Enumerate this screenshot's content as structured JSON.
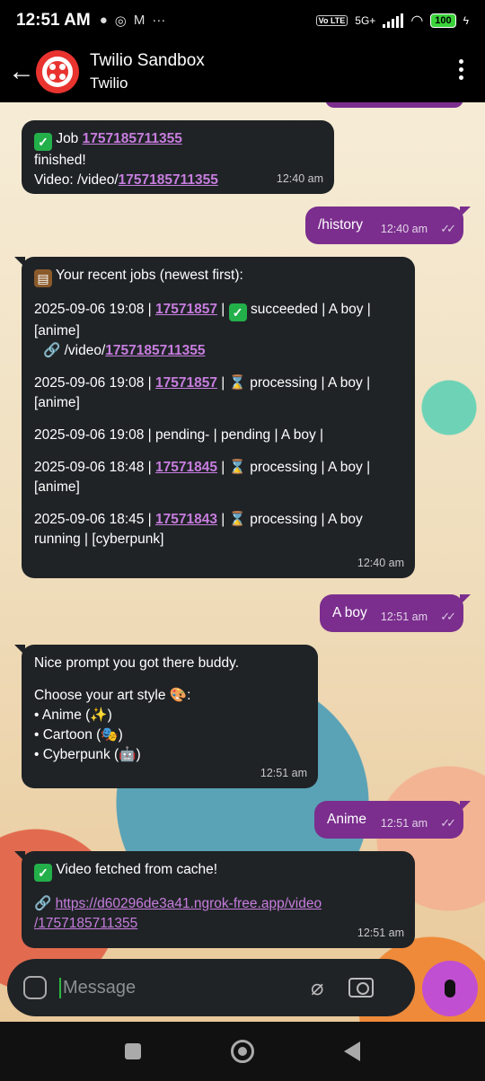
{
  "status_bar": {
    "time": "12:51 AM",
    "notification_icons": [
      "chat-bubble-icon",
      "instagram-icon",
      "gmail-icon",
      "more-dots-icon"
    ],
    "network": "5G+",
    "battery": "100"
  },
  "header": {
    "title": "Twilio Sandbox",
    "subtitle": "Twilio"
  },
  "messages": [
    {
      "direction": "in",
      "job_prefix": "Job",
      "job_id": "1757185711355",
      "line2": "finished!",
      "video_prefix": "Video: /video/",
      "video_id": "1757185711355",
      "time": "12:40 am"
    },
    {
      "direction": "out",
      "text": "/history",
      "time": "12:40 am"
    },
    {
      "direction": "in",
      "heading": "Your recent jobs (newest first):",
      "jobs": [
        {
          "date": "2025-09-06 19:08 |",
          "id": "17571857",
          "status": "succeeded | A boy |",
          "tag": "[anime]",
          "link_prefix": "/video/",
          "link_id": "1757185711355"
        },
        {
          "date": "2025-09-06 19:08 |",
          "id": "17571857",
          "status": "processing | A boy |",
          "tag": "[anime]"
        },
        {
          "plain": "2025-09-06 19:08 | pending- |  pending | A boy |"
        },
        {
          "date": "2025-09-06 18:48 |",
          "id": "17571845",
          "status": "processing | A boy |",
          "tag": "[anime]"
        },
        {
          "date": "2025-09-06 18:45 |",
          "id": "17571843",
          "status": "processing | A boy",
          "tag": "running |  [cyberpunk]"
        }
      ],
      "time": "12:40 am"
    },
    {
      "direction": "out",
      "text": "A boy",
      "time": "12:51 am"
    },
    {
      "direction": "in",
      "line1": "Nice prompt you got there buddy.",
      "line2": "Choose your art style",
      "options": [
        "• Anime (",
        "• Cartoon (",
        "• Cyberpunk ("
      ],
      "time": "12:51 am"
    },
    {
      "direction": "out",
      "text": "Anime",
      "time": "12:51 am"
    },
    {
      "direction": "in",
      "line1": "Video fetched from cache!",
      "url_part1": "https://d60296de3a41.ngrok-free.app/video",
      "url_part2": "/1757185711355",
      "time": "12:51 am"
    }
  ],
  "composer": {
    "placeholder": "Message"
  },
  "colors": {
    "incoming_bubble": "#1f2326",
    "outgoing_bubble": "#7b2e8e",
    "link": "#c77dde",
    "mic_button": "#c14fd2"
  }
}
